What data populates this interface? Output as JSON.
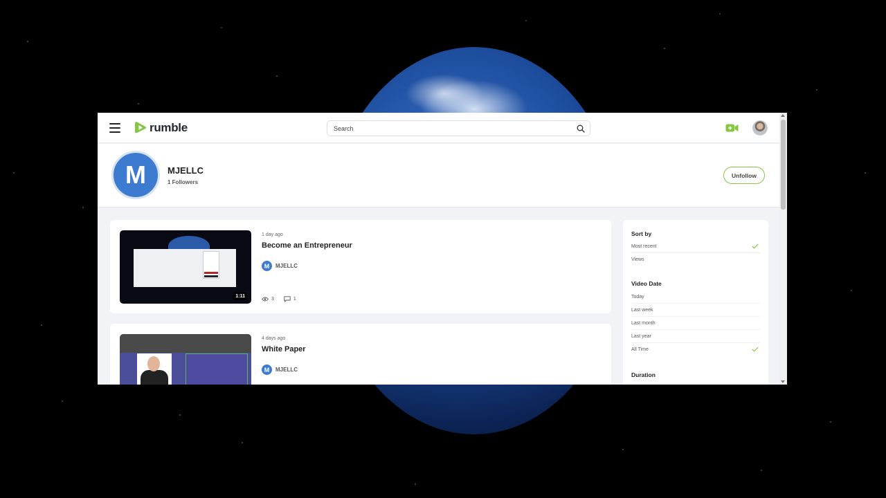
{
  "colors": {
    "brand_green": "#85c742",
    "avatar_blue": "#3d7bd0",
    "page_bg": "#f2f3f6"
  },
  "header": {
    "logo_text": "rumble",
    "search_placeholder": "Search"
  },
  "channel": {
    "avatar_letter": "M",
    "name": "MJELLC",
    "followers": "1 Followers",
    "unfollow_label": "Unfollow"
  },
  "videos": [
    {
      "time": "1 day ago",
      "title": "Become an Entrepreneur",
      "channel_letter": "M",
      "channel": "MJELLC",
      "duration": "1:11",
      "views": "3",
      "comments": "1"
    },
    {
      "time": "4 days ago",
      "title": "White Paper",
      "channel_letter": "M",
      "channel": "MJELLC"
    }
  ],
  "filters": {
    "sort_by": {
      "title": "Sort by",
      "options": [
        "Most recent",
        "Views"
      ],
      "selected": "Most recent"
    },
    "video_date": {
      "title": "Video Date",
      "options": [
        "Today",
        "Last week",
        "Last month",
        "Last year",
        "All Time"
      ],
      "selected": "All Time"
    },
    "duration": {
      "title": "Duration"
    }
  }
}
